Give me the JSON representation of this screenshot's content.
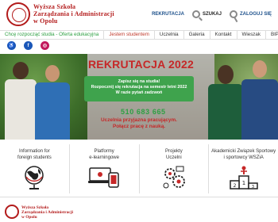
{
  "header": {
    "logo_lines": [
      "Wyższa Szkoła",
      "Zarządzania i Administracji",
      "w Opolu"
    ],
    "recruitment_label": "REKRUTACJA",
    "search_label": "SZUKAJ",
    "login_label": "ZALOGUJ SIĘ"
  },
  "nav": {
    "items": [
      {
        "label": "Chcę rozpocząć studia - Oferta edukacyjna"
      },
      {
        "label": "Jestem studentem"
      },
      {
        "label": "Uczelnia"
      },
      {
        "label": "Galeria"
      },
      {
        "label": "Kontakt"
      },
      {
        "label": "Wieszak"
      },
      {
        "label": "BIP"
      }
    ]
  },
  "social": {
    "icons": [
      {
        "name": "accessibility-icon",
        "glyph": "♿"
      },
      {
        "name": "facebook-icon",
        "glyph": "f"
      },
      {
        "name": "instagram-icon",
        "glyph": "◎"
      }
    ]
  },
  "hero": {
    "title": "REKRUTACJA 2022",
    "box_lines": [
      "Zapisz się na studia!",
      "Rozpocznij się rekrutacja na semestr letni 2022",
      "W razie pytań zadzwoń"
    ],
    "phone": "510 683 665",
    "tagline_lines": [
      "Uczelnia przyjazna pracującym.",
      "Połącz pracę z nauką."
    ]
  },
  "tiles": [
    {
      "label_lines": [
        "Information for",
        "foreign students"
      ],
      "icon": "globe-icon"
    },
    {
      "label_lines": [
        "Platformy",
        "e-learningowe"
      ],
      "icon": "devices-icon"
    },
    {
      "label_lines": [
        "Projekty",
        "Uczelni"
      ],
      "icon": "gears-icon"
    },
    {
      "label_lines": [
        "Akademicki Związek Sportowy",
        "i sportowcy WSZiA"
      ],
      "icon": "podium-icon"
    }
  ],
  "footer": {
    "logo_lines": [
      "Wyższa Szkoła",
      "Zarządzania i Administracji",
      "w Opolu"
    ]
  },
  "colors": {
    "brand_red": "#b31b1b",
    "accent_green": "#3fa34d",
    "link_blue": "#1b4f8a"
  }
}
